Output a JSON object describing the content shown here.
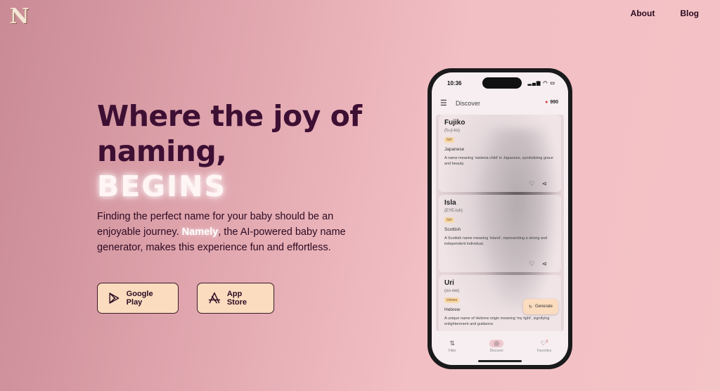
{
  "logo": {
    "letter": "N"
  },
  "nav": {
    "about": "About",
    "blog": "Blog"
  },
  "hero": {
    "title_line1": "Where the joy of",
    "title_line2": "naming,",
    "title_line3": "BEGINS",
    "desc_before": "Finding the perfect name for your baby should be an enjoyable journey. ",
    "desc_brand": "Namely",
    "desc_after": ", the AI-powered baby name generator, makes this experience fun and effortless."
  },
  "buttons": {
    "google_play": "Google Play",
    "app_store": "App Store"
  },
  "phone": {
    "time": "10:36",
    "status_icons": "▂▄▆ ◠ ▭",
    "appbar_title": "Discover",
    "coins": "990",
    "cards": [
      {
        "name": "Fujiko",
        "pron": "(fu-ji-ko)",
        "tag": "Girl",
        "origin": "Japanese",
        "meaning": "A name meaning 'wisteria child' in Japanese, symbolizing grace and beauty."
      },
      {
        "name": "Isla",
        "pron": "(EYE-luh)",
        "tag": "Girl",
        "origin": "Scottish",
        "meaning": "A Scottish name meaning 'island', representing a strong and independent individual."
      },
      {
        "name": "Uri",
        "pron": "(oo-ree)",
        "tag": "Unisex",
        "origin": "Hebrew",
        "meaning": "A unique name of Hebrew origin meaning 'my light', signifying enlightenment and guidance."
      }
    ],
    "generate_label": "Generate",
    "nav": {
      "filter": "Filter",
      "discover": "Discover",
      "favorites": "Favorites",
      "fav_count": "2"
    }
  }
}
